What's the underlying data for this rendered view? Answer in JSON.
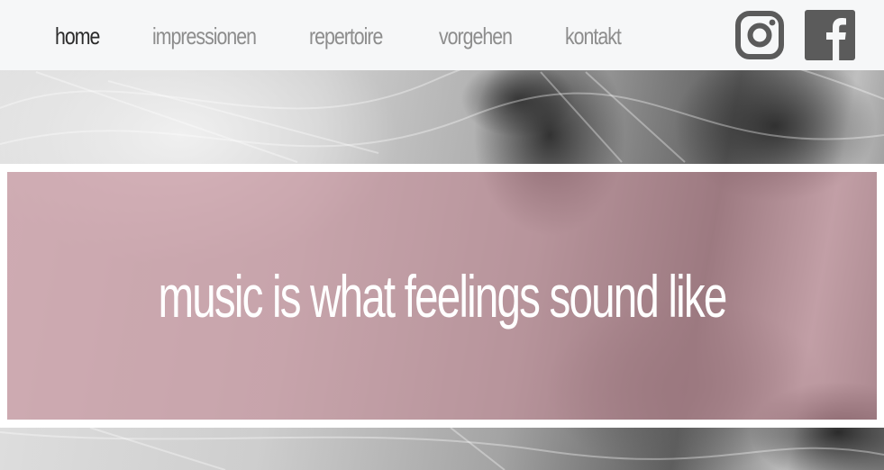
{
  "nav": {
    "items": [
      {
        "label": "home",
        "active": true
      },
      {
        "label": "impressionen",
        "active": false
      },
      {
        "label": "repertoire",
        "active": false
      },
      {
        "label": "vorgehen",
        "active": false
      },
      {
        "label": "kontakt",
        "active": false
      }
    ],
    "social": [
      {
        "icon": "instagram-icon"
      },
      {
        "icon": "facebook-icon"
      }
    ]
  },
  "hero": {
    "tagline": "music is what feelings sound like"
  },
  "colors": {
    "nav_background": "#f6f7f8",
    "nav_active": "#2b2b2b",
    "nav_inactive": "#8d8d8d",
    "icon": "#5b5b5b",
    "hero_overlay": "#c48a96",
    "tagline": "#ffffff"
  }
}
